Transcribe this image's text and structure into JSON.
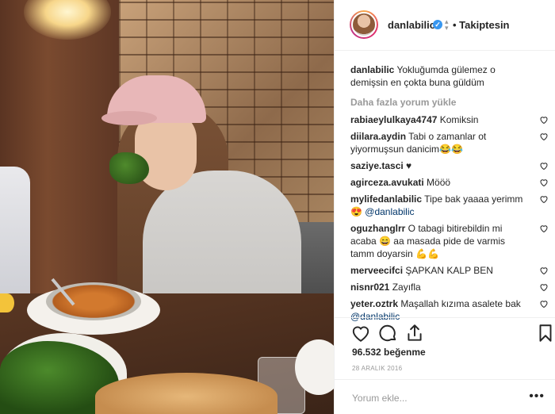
{
  "post": {
    "username": "danlabilic",
    "verified_symbol": "✓",
    "follow_status": "• Takiptesin",
    "caption_user": "danlabilic",
    "caption_text": " Yokluğumda gülemez o demişsin en çokta buna güldüm",
    "load_more": "Daha fazla yorum yükle",
    "likes": "96.532 beğenme",
    "date": "28 ARALIK 2016",
    "comment_placeholder": "Yorum ekle...",
    "more_symbol": "•••"
  },
  "comments": [
    {
      "user": "rabiaeylulkaya4747",
      "text": " Komiksin"
    },
    {
      "user": "diilara.aydin",
      "text": " Tabi o zamanlar ot yiyormuşsun danicim😂😂"
    },
    {
      "user": "saziye.tasci",
      "text": " ♥"
    },
    {
      "user": "agirceza.avukati",
      "text": " Mööö"
    },
    {
      "user": "mylifedanlabilic",
      "text": " Tipe bak yaaaa yerimm 😍 ",
      "mention": "@danlabilic"
    },
    {
      "user": "oguzhanglrr",
      "text": " O tabagi bitirebildin mi acaba 😄 aa masada pide de varmis tamm doyarsin 💪💪"
    },
    {
      "user": "merveecifci",
      "text": " ŞAPKAN KALP BEN"
    },
    {
      "user": "nisnr021",
      "text": " Zayıfla"
    },
    {
      "user": "yeter.oztrk",
      "text": " Maşallah kızıma asalete bak ",
      "mention": "@danlabilic"
    }
  ],
  "icons": {
    "like": "heart-icon",
    "comment": "comment-icon",
    "share": "share-icon",
    "save": "bookmark-icon"
  },
  "colors": {
    "text": "#262626",
    "muted": "#999999",
    "mention": "#003569",
    "verified": "#3897f0",
    "border": "#efefef"
  }
}
